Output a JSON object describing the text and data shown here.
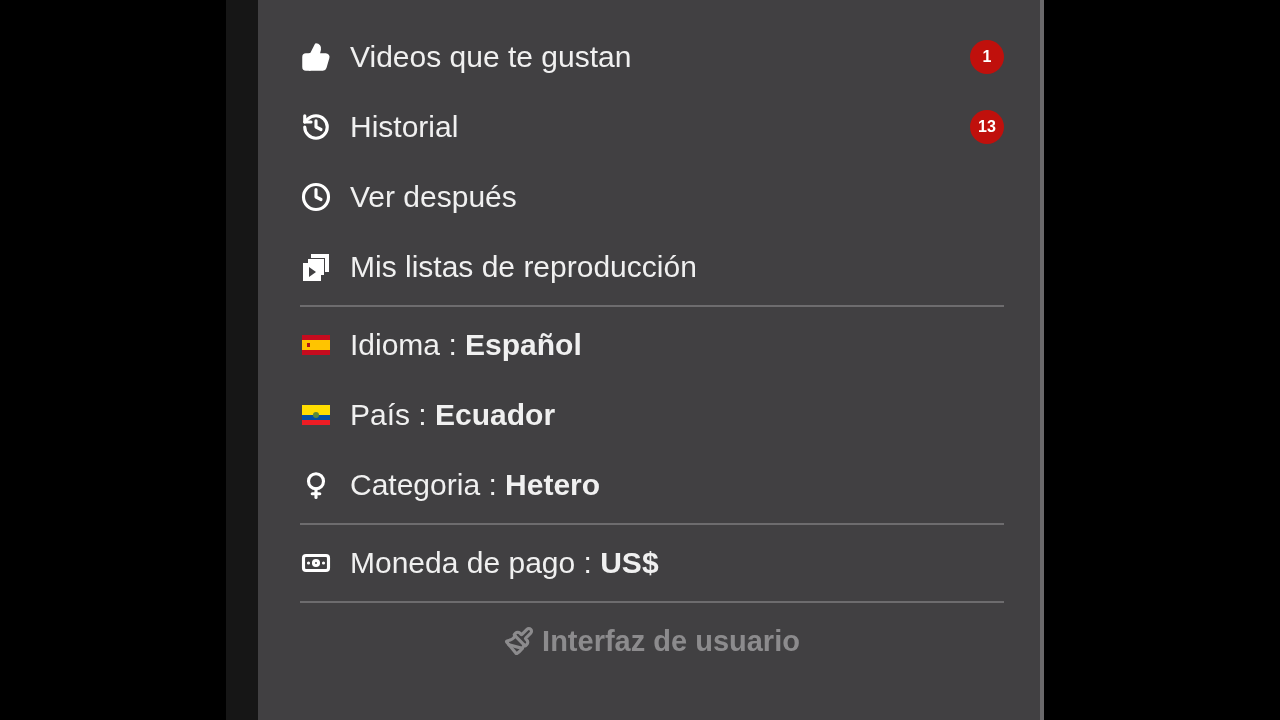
{
  "menu": {
    "sections": [
      {
        "items": [
          {
            "kind": "like",
            "label": "Videos que te gustan",
            "badge": "1"
          },
          {
            "kind": "history",
            "label": "Historial",
            "badge": "13"
          },
          {
            "kind": "clock",
            "label": "Ver después"
          },
          {
            "kind": "playlist",
            "label": "Mis listas de reproducción"
          }
        ]
      },
      {
        "items": [
          {
            "kind": "spain",
            "label": "Idioma : **Español**"
          },
          {
            "kind": "ecuador",
            "label": "País : **Ecuador**"
          },
          {
            "kind": "female",
            "label": "Categoria : **Hetero**"
          }
        ]
      },
      {
        "items": [
          {
            "kind": "money",
            "label": "Moneda de pago : **US$**"
          }
        ]
      },
      {
        "heading": "Interfaz de usuario"
      }
    ]
  }
}
